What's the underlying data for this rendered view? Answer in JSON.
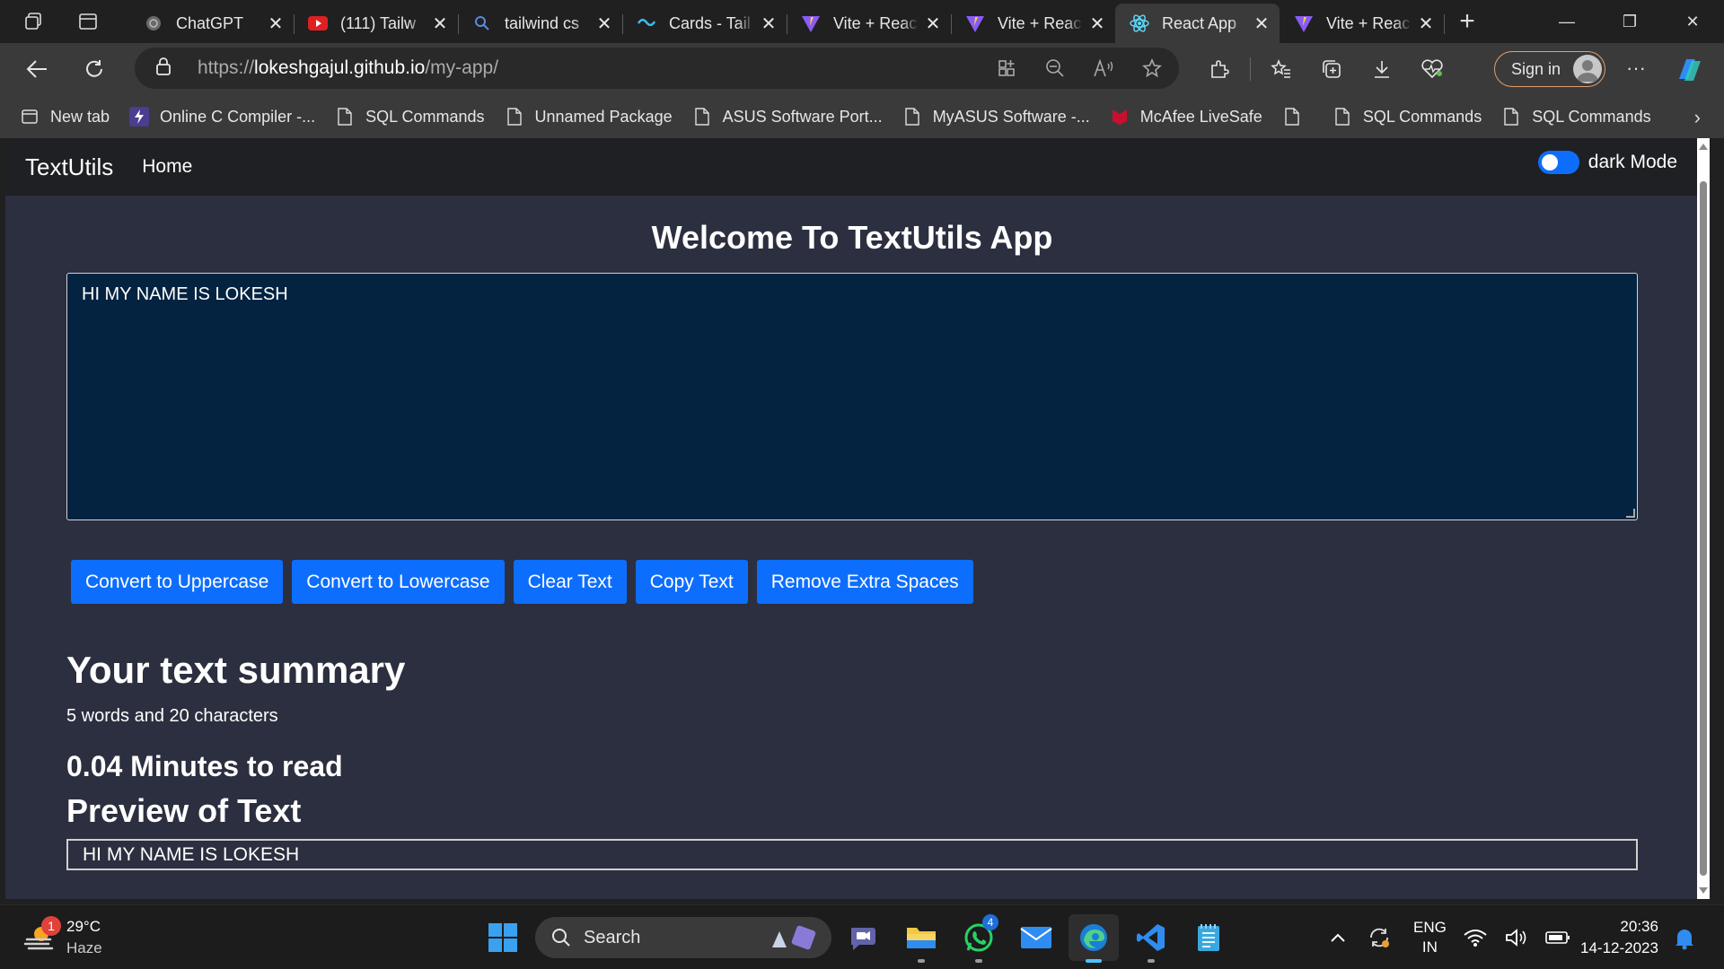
{
  "browser": {
    "tabs": [
      {
        "label": "ChatGPT",
        "icon": "chatgpt-icon"
      },
      {
        "label": "(111) Tailw",
        "icon": "youtube-icon"
      },
      {
        "label": "tailwind cs",
        "icon": "search-icon"
      },
      {
        "label": "Cards - Tail",
        "icon": "tailwind-icon"
      },
      {
        "label": "Vite + Reac",
        "icon": "vite-icon"
      },
      {
        "label": "Vite + Reac",
        "icon": "vite-icon"
      },
      {
        "label": "React App",
        "icon": "react-icon",
        "active": true
      },
      {
        "label": "Vite + Reac",
        "icon": "vite-icon"
      }
    ],
    "url": {
      "scheme": "https://",
      "host": "lokeshgajul.github.io",
      "path": "/my-app/"
    },
    "sign_in": "Sign in",
    "favorites": [
      {
        "label": "New tab",
        "icon": "newtab-icon"
      },
      {
        "label": "Online C Compiler -...",
        "icon": "bolt-icon"
      },
      {
        "label": "SQL Commands",
        "icon": "page-icon"
      },
      {
        "label": "Unnamed Package",
        "icon": "page-icon"
      },
      {
        "label": "ASUS Software Port...",
        "icon": "page-icon"
      },
      {
        "label": "MyASUS Software -...",
        "icon": "page-icon"
      },
      {
        "label": "McAfee LiveSafe",
        "icon": "mcafee-icon"
      },
      {
        "label": "",
        "icon": "page-icon"
      },
      {
        "label": "SQL Commands",
        "icon": "page-icon"
      },
      {
        "label": "SQL Commands",
        "icon": "page-icon"
      }
    ]
  },
  "app": {
    "brand": "TextUtils",
    "nav_home": "Home",
    "mode_label": "dark Mode",
    "dark_mode_on": true,
    "title": "Welcome To TextUtils App",
    "textarea_value": "HI MY NAME IS LOKESH",
    "buttons": [
      "Convert to Uppercase",
      "Convert to Lowercase",
      "Clear Text",
      "Copy Text",
      "Remove Extra Spaces"
    ],
    "summary_heading": "Your text summary",
    "summary_text": "5 words and 20 characters",
    "read_time": "0.04 Minutes to read",
    "preview_heading": "Preview of Text",
    "preview_text": "HI MY NAME IS LOKESH"
  },
  "taskbar": {
    "weather_temp": "29°C",
    "weather_desc": "Haze",
    "weather_badge": "1",
    "search_placeholder": "Search",
    "whatsapp_badge": "4",
    "lang_line1": "ENG",
    "lang_line2": "IN",
    "time": "20:36",
    "date": "14-12-2023"
  },
  "colors": {
    "accent": "#0d6efd",
    "page_bg": "#2c2f3f",
    "textarea_bg": "#042341",
    "navbar_bg": "#1f2024"
  }
}
